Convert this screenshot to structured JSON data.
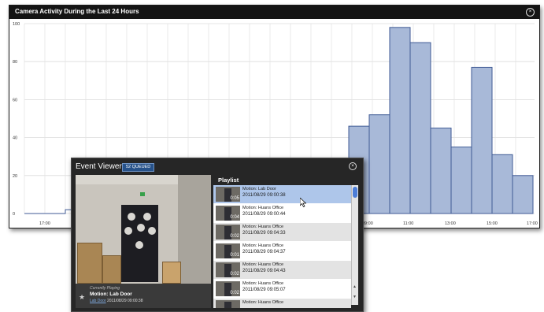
{
  "chart_panel": {
    "title": "Camera Activity During the Last 24 Hours",
    "close_icon": "close-circle-icon"
  },
  "chart_data": {
    "type": "bar",
    "title": "Camera Activity During the Last 24 Hours",
    "xlabel": "",
    "ylabel": "",
    "ylim": [
      0,
      100
    ],
    "ytick_labels": [
      "0",
      "20",
      "40",
      "60",
      "80",
      "100"
    ],
    "xtick_labels": [
      "17:00",
      "09:00",
      "11:00",
      "13:00",
      "15:00",
      "17:00"
    ],
    "grid": true,
    "bar_color": "#a8b9d8",
    "bar_edge_color": "#3f5a94",
    "visible_bars": [
      {
        "hour": "08:00",
        "value": 46
      },
      {
        "hour": "09:00",
        "value": 52
      },
      {
        "hour": "10:00",
        "value": 98
      },
      {
        "hour": "11:00",
        "value": 90
      },
      {
        "hour": "12:00",
        "value": 45
      },
      {
        "hour": "13:00",
        "value": 35
      },
      {
        "hour": "14:00",
        "value": 77
      },
      {
        "hour": "15:00",
        "value": 31
      },
      {
        "hour": "16:00",
        "value": 20
      }
    ],
    "baseline_step_value": 2
  },
  "event_viewer": {
    "title": "Event Viewer",
    "queued_badge": "52 QUEUED",
    "close_icon": "close-circle-icon",
    "currently_playing_label": "Currently Playing",
    "currently_playing_title": "Motion: Lab Door",
    "currently_playing_camera": "Lab Door",
    "currently_playing_datetime": "2011/08/29  09:00:38",
    "playlist_title": "Playlist",
    "playlist": [
      {
        "title": "Motion: Lab Door",
        "datetime": "2011/08/29  09:00:38",
        "duration": "0:05",
        "selected": true
      },
      {
        "title": "Motion: Huans Office",
        "datetime": "2011/08/29  09:00:44",
        "duration": "0:04",
        "selected": false
      },
      {
        "title": "Motion: Huans Office",
        "datetime": "2011/08/29  09:04:33",
        "duration": "0:02",
        "selected": false
      },
      {
        "title": "Motion: Huans Office",
        "datetime": "2011/08/29  09:04:37",
        "duration": "0:01",
        "selected": false
      },
      {
        "title": "Motion: Huans Office",
        "datetime": "2011/08/29  09:04:43",
        "duration": "0:02",
        "selected": false
      },
      {
        "title": "Motion: Huans Office",
        "datetime": "2011/08/29  09:05:07",
        "duration": "0:02",
        "selected": false
      },
      {
        "title": "Motion: Huans Office",
        "datetime": "",
        "duration": "",
        "selected": false
      }
    ]
  }
}
